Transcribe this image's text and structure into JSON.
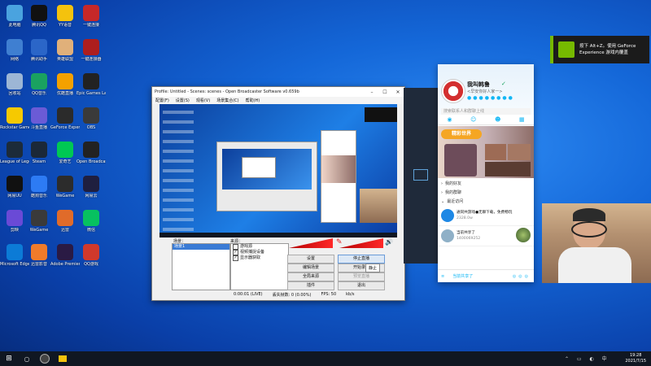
{
  "desktop": {
    "icons": [
      {
        "label": "此电脑",
        "color": "#4aa3df"
      },
      {
        "label": "腾讯QQ",
        "color": "#111111"
      },
      {
        "label": "YY语音",
        "color": "#f4c20d"
      },
      {
        "label": "一键连接",
        "color": "#c62828"
      },
      {
        "label": "网络",
        "color": "#3f7fd1"
      },
      {
        "label": "腾讯助手",
        "color": "#2b66c8"
      },
      {
        "label": "英雄联盟",
        "color": "#e0b07a"
      },
      {
        "label": "一键连接器",
        "color": "#ad1e1e"
      },
      {
        "label": "回收站",
        "color": "#9db6d5"
      },
      {
        "label": "QQ音乐",
        "color": "#1aa260"
      },
      {
        "label": "优酷直播",
        "color": "#f4a100"
      },
      {
        "label": "Epic Games Launcher",
        "color": "#222222"
      },
      {
        "label": "Rockstar Games",
        "color": "#f6c900"
      },
      {
        "label": "斗鱼直播",
        "color": "#6b5bd6"
      },
      {
        "label": "GeForce Experience",
        "color": "#2b2b2b"
      },
      {
        "label": "OBS",
        "color": "#3a3a3a"
      },
      {
        "label": "League of Legends",
        "color": "#1c2b3a"
      },
      {
        "label": "Steam",
        "color": "#1b2838"
      },
      {
        "label": "爱奇艺",
        "color": "#00c853"
      },
      {
        "label": "Open Broadcaster",
        "color": "#222"
      },
      {
        "label": "网易UU",
        "color": "#111"
      },
      {
        "label": "酷狗音乐",
        "color": "#2d7bf4"
      },
      {
        "label": "WeGame",
        "color": "#2c2c2c"
      },
      {
        "label": "网易云",
        "color": "#1f1f3f"
      },
      {
        "label": "剪映",
        "color": "#6a4ad6"
      },
      {
        "label": "WeGame",
        "color": "#3a3a3a"
      },
      {
        "label": "迅雷",
        "color": "#e06b2a"
      },
      {
        "label": "微信",
        "color": "#07c160"
      },
      {
        "label": "Microsoft Edge",
        "color": "#0c7bd6"
      },
      {
        "label": "迅雷影音",
        "color": "#f07b2a"
      },
      {
        "label": "Adobe Premiere",
        "color": "#2a1a44"
      },
      {
        "label": "QQ游戏",
        "color": "#d0392b"
      }
    ]
  },
  "obs": {
    "title": "Profile: Untitled - Scenes: scenes - Open Broadcaster Software v0.659b",
    "menu": [
      "配置(F)",
      "设置(S)",
      "观看(V)",
      "场景集合(C)",
      "帮助(H)"
    ],
    "scenes_label": "场景：",
    "sources_label": "来源：",
    "scene_selected": "场景1",
    "sources": [
      {
        "label": "游戏源",
        "checked": false
      },
      {
        "label": "视频捕捉设备",
        "checked": true
      },
      {
        "label": "显示器获取",
        "checked": true
      }
    ],
    "buttons": {
      "settings": "设置",
      "stop": "停止直播",
      "edit_scene": "编辑场景",
      "start_record": "开始录制",
      "global_sources": "全局来源",
      "preview": "预览直播",
      "plugins": "插件",
      "exit": "退出"
    },
    "tooltip": "静止",
    "status": {
      "time": "0:00:01 (LIVE)",
      "dropped": "丢失帧数: 0 (0.00%)",
      "fps": "FPS: 50",
      "bitrate": "kb/s"
    }
  },
  "qq": {
    "name": "我叫韩鲁",
    "signature": "<早安你好人家一>",
    "search_placeholder": "搜索联系人和群聊上线",
    "banner": "精彩世界",
    "sections": [
      "我的好友",
      "我的群聊",
      "最近访问"
    ],
    "messages": [
      {
        "title": "通同共游戏●无聊下载，免费畅玩",
        "sub": "2328.0w"
      },
      {
        "title": "当前共享了",
        "sub": "1400069252"
      }
    ],
    "bottom_label": "当前共享了"
  },
  "nvidia": {
    "line1": "按下 Alt+Z。使用 GeForce",
    "line2": "Experience 游戏内覆盖"
  },
  "taskbar": {
    "time": "19:28",
    "date": "2021/7/15"
  },
  "colors": {
    "qq_accent": "#12b7f5",
    "obs_meter": "#e02020",
    "nvidia_green": "#76b900"
  }
}
